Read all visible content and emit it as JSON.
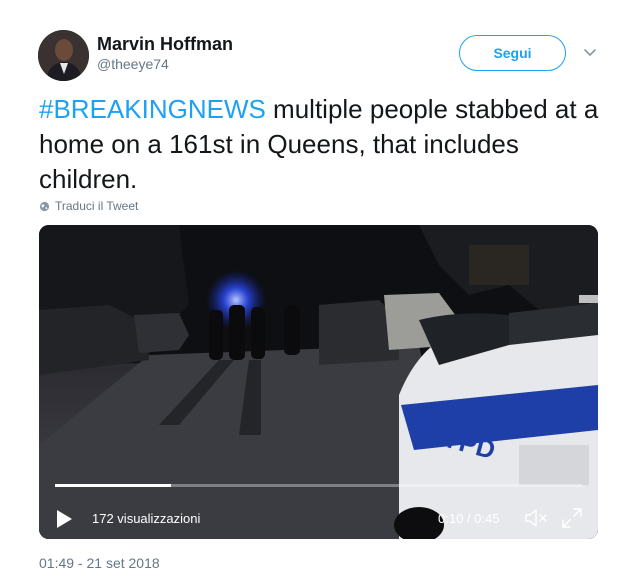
{
  "user": {
    "name": "Marvin Hoffman",
    "handle": "@theeye74"
  },
  "follow_button": {
    "label": "Segui"
  },
  "tweet": {
    "hashtag": "#BREAKINGNEWS",
    "text": " multiple people stabbed at a home on a 161st in Queens, that includes children."
  },
  "translate": {
    "label": "Traduci il Tweet",
    "icon": "globe-icon"
  },
  "video": {
    "views": "172 visualizzazioni",
    "time": "0:10 / 0:45",
    "progress_fraction": 0.22,
    "icons": [
      "play-icon",
      "mute-icon",
      "fullscreen-icon"
    ]
  },
  "timestamp": "01:49 - 21 set 2018",
  "colors": {
    "accent": "#1da1f2",
    "secondary_text": "#657786",
    "primary_text": "#14171a"
  }
}
